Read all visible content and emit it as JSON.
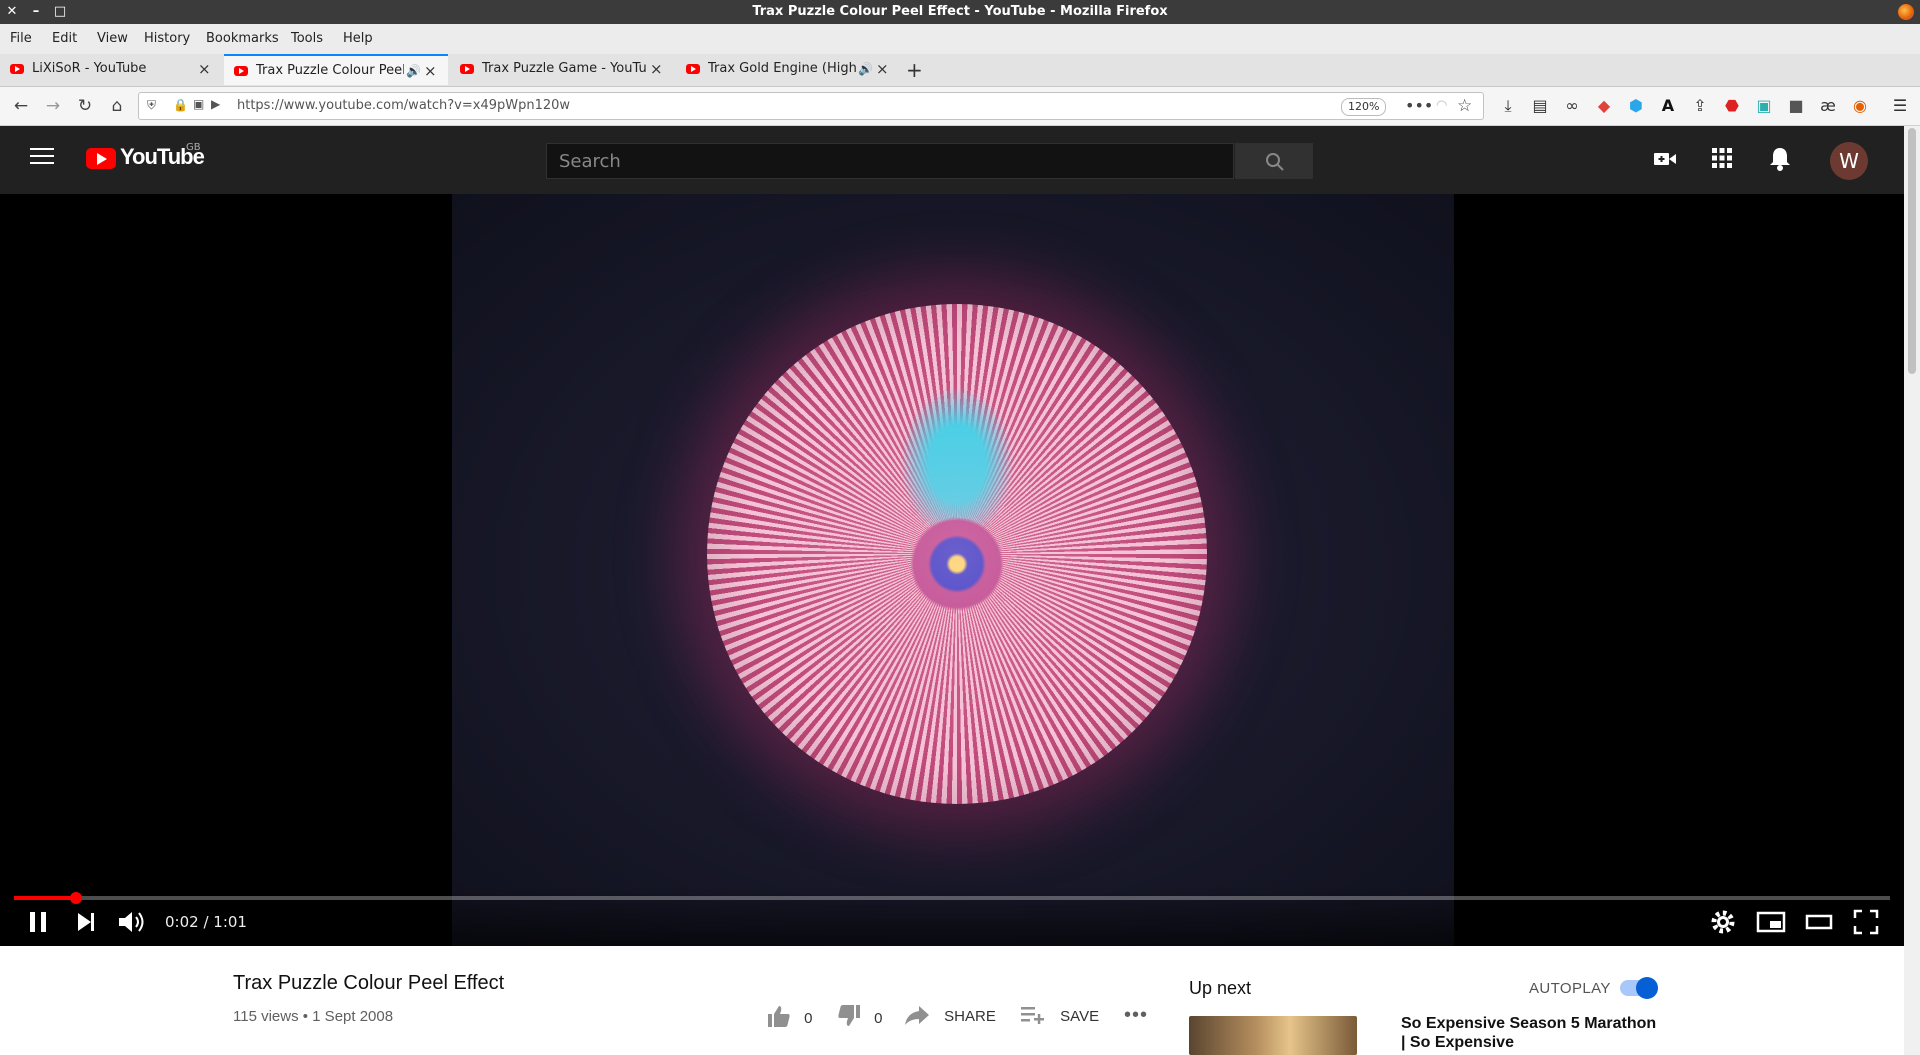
{
  "window": {
    "title": "Trax Puzzle Colour Peel Effect - YouTube - Mozilla Firefox"
  },
  "menu": {
    "items": [
      "File",
      "Edit",
      "View",
      "History",
      "Bookmarks",
      "Tools",
      "Help"
    ]
  },
  "tabs": [
    {
      "label": "LiXiSoR - YouTube",
      "active": false
    },
    {
      "label": "Trax Puzzle Colour Peel Ef",
      "active": true
    },
    {
      "label": "Trax Puzzle Game - YouTube",
      "active": false
    },
    {
      "label": "Trax Gold Engine (High Sp",
      "active": false
    }
  ],
  "nav": {
    "url": "https://www.youtube.com/watch?v=x49pWpn120w",
    "zoom": "120%"
  },
  "youtube": {
    "logo_text": "YouTube",
    "country": "GB",
    "search_placeholder": "Search",
    "avatar_initial": "W"
  },
  "player": {
    "time": "0:02 / 1:01",
    "progress_fraction": 0.033
  },
  "video": {
    "title": "Trax Puzzle Colour Peel Effect",
    "meta": "115 views • 1 Sept 2008",
    "likes": "0",
    "dislikes": "0",
    "share_label": "SHARE",
    "save_label": "SAVE"
  },
  "sidebar": {
    "up_next": "Up next",
    "autoplay": "AUTOPLAY",
    "recommendation_title": "So Expensive Season 5 Marathon | So Expensive"
  },
  "colors": {
    "accent": "#ff0000",
    "toggle": "#065fd4",
    "header_bg": "#212121"
  }
}
